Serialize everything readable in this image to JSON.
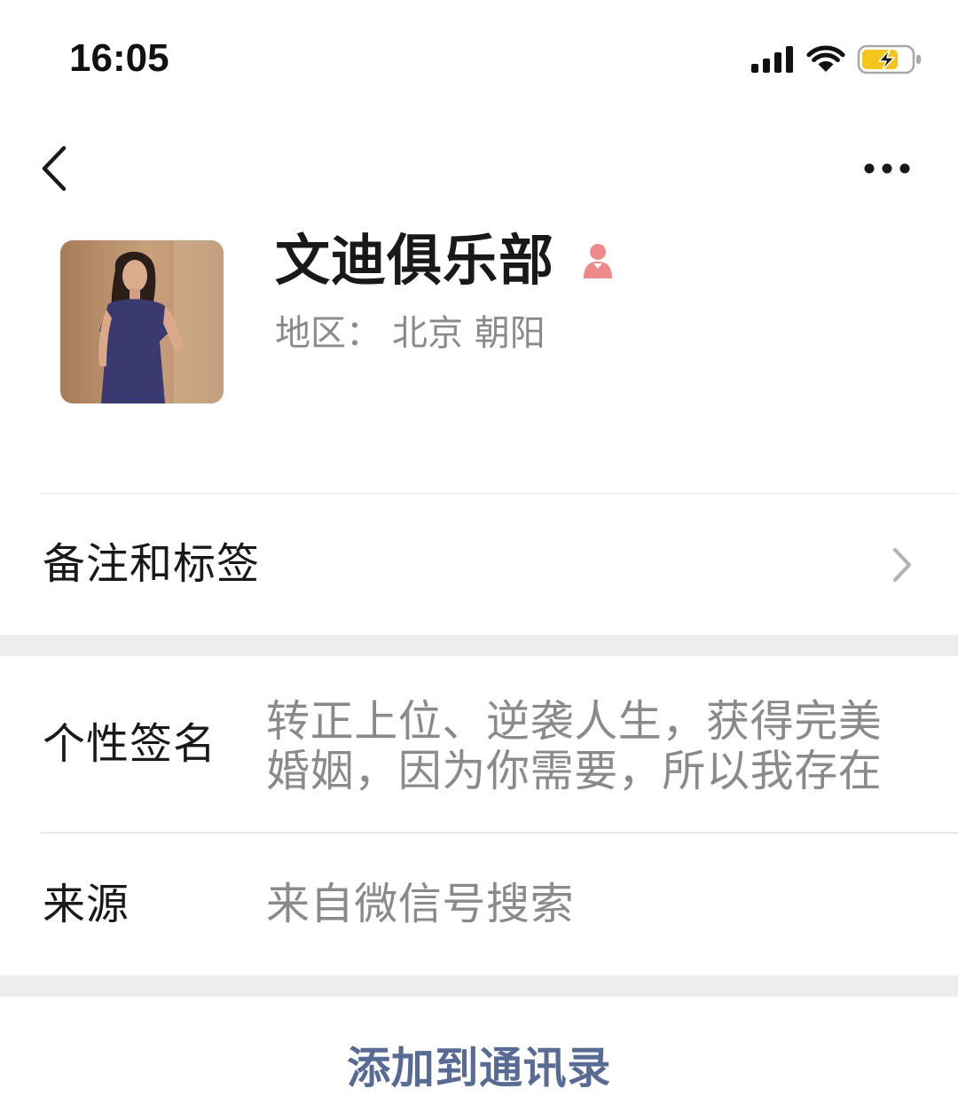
{
  "status_bar": {
    "time": "16:05",
    "icons": [
      "cellular-signal-icon",
      "wifi-icon",
      "battery-charging-icon"
    ]
  },
  "nav_bar": {
    "back_icon": "chevron-left-icon",
    "more_icon": "more-dots-icon"
  },
  "profile": {
    "name": "文迪俱乐部",
    "gender_icon": "female-icon",
    "region_label": "地区：",
    "region_value": "北京 朝阳"
  },
  "rows": {
    "remarks": {
      "label": "备注和标签",
      "icon": "chevron-right-icon"
    },
    "signature": {
      "label": "个性签名",
      "value": "转正上位、逆袭人生，获得完美婚姻，因为你需要，所以我存在"
    },
    "source": {
      "label": "来源",
      "value": "来自微信号搜索"
    }
  },
  "action": {
    "add_to_contacts": "添加到通讯录"
  },
  "colors": {
    "link": "#576b95",
    "primary_text": "#191919",
    "secondary_text": "#8a8a8a",
    "section_gap": "#ededed",
    "gender_female": "#ef8a8a",
    "battery_charge": "#f4c51c"
  }
}
